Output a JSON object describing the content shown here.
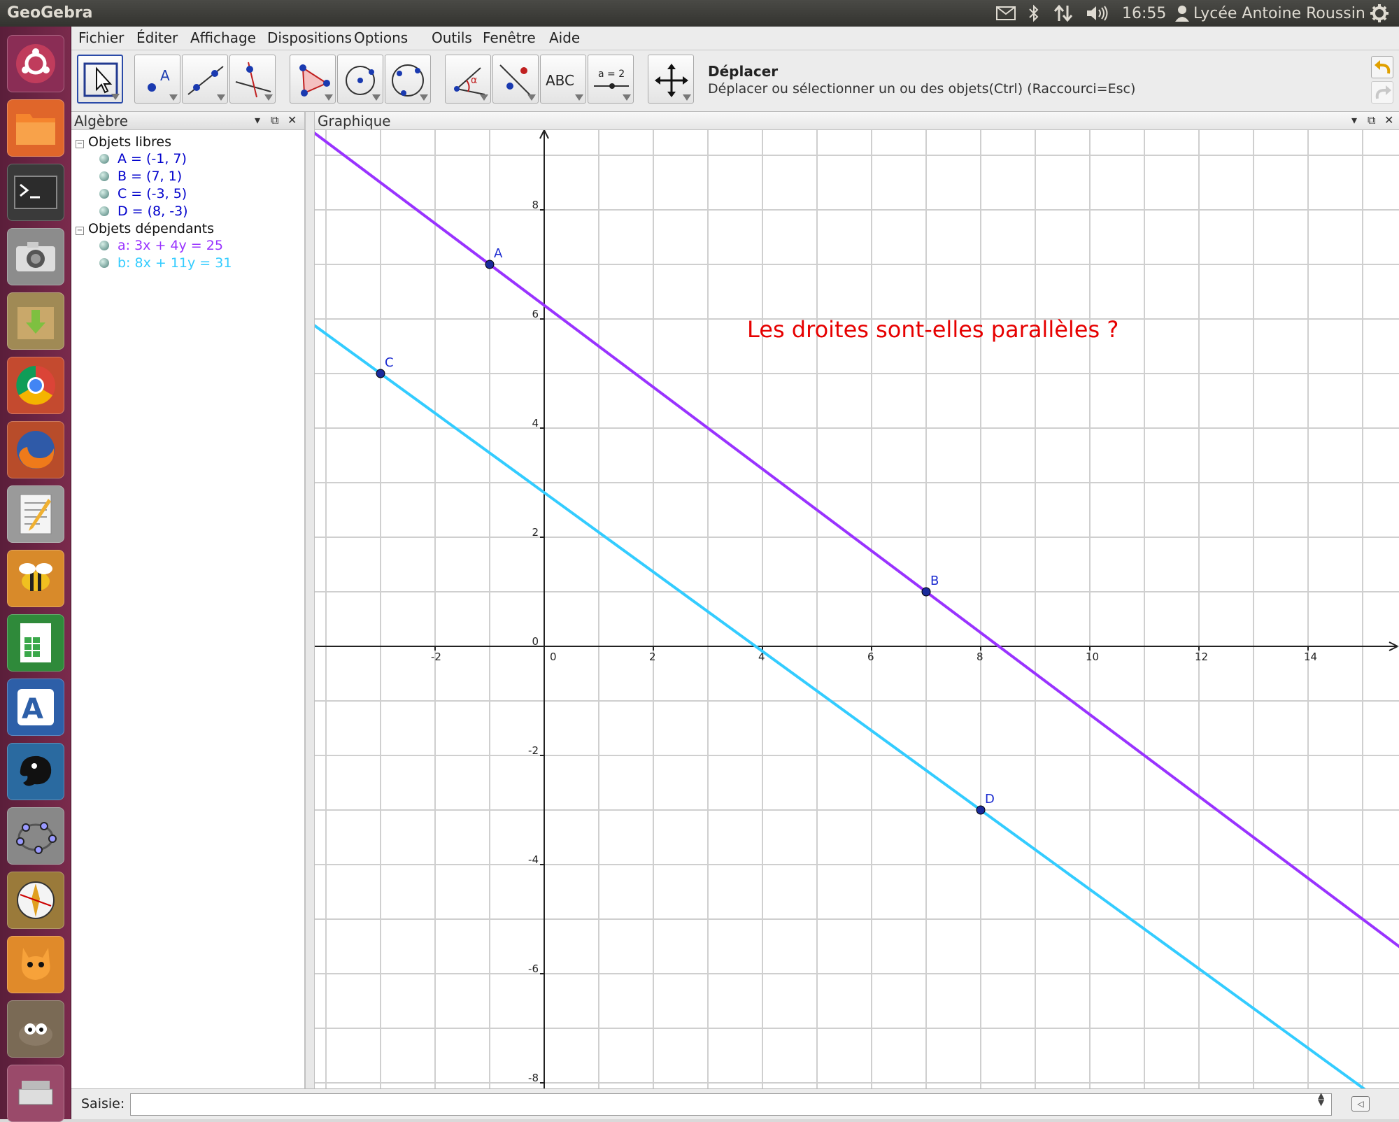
{
  "topbar": {
    "title": "GeoGebra",
    "time": "16:55",
    "user": "Lycée Antoine Roussin",
    "icons": [
      "mail-icon",
      "bluetooth-icon",
      "network-icon",
      "volume-icon",
      "user-icon",
      "settings-gear-icon"
    ]
  },
  "launcher": {
    "apps": [
      "ubuntu-home",
      "files",
      "terminal",
      "camera",
      "archive-manager",
      "chrome",
      "firefox",
      "text-editor",
      "bee-app",
      "spreadsheet",
      "algo-app",
      "gimp-paw",
      "geogebra",
      "compass-app",
      "scratch",
      "gimp",
      "scanner"
    ]
  },
  "menu": {
    "items": [
      "Fichier",
      "Éditer",
      "Affichage",
      "Dispositions",
      "Options",
      "Outils",
      "Fenêtre",
      "Aide"
    ]
  },
  "toolbar": {
    "tool_name": "Déplacer",
    "tool_desc": "Déplacer ou sélectionner un ou des objets(Ctrl) (Raccourci=Esc)",
    "abc_label": "ABC",
    "slider_label": "a = 2"
  },
  "algebra": {
    "title": "Algèbre",
    "free_header": "Objets libres",
    "free": [
      {
        "text": "A = (-1, 7)",
        "color": "#0000cc"
      },
      {
        "text": "B = (7, 1)",
        "color": "#0000cc"
      },
      {
        "text": "C = (-3, 5)",
        "color": "#0000cc"
      },
      {
        "text": "D = (8, -3)",
        "color": "#0000cc"
      }
    ],
    "dep_header": "Objets dépendants",
    "dependent": [
      {
        "text": "a: 3x + 4y = 25",
        "color": "#9933ff"
      },
      {
        "text": "b: 8x + 11y = 31",
        "color": "#33ccff"
      }
    ]
  },
  "graphics": {
    "title": "Graphique",
    "question": "Les droites sont-elles parallèles ?",
    "question_color": "#e60000"
  },
  "chart_data": {
    "type": "line",
    "xlim": [
      -4,
      15.5
    ],
    "ylim": [
      -8.5,
      9
    ],
    "grid": true,
    "x_ticks": [
      -2,
      0,
      2,
      4,
      6,
      8,
      10,
      12,
      14
    ],
    "y_ticks": [
      -8,
      -6,
      -4,
      -2,
      0,
      2,
      4,
      6,
      8
    ],
    "points": [
      {
        "name": "A",
        "x": -1,
        "y": 7
      },
      {
        "name": "B",
        "x": 7,
        "y": 1
      },
      {
        "name": "C",
        "x": -3,
        "y": 5
      },
      {
        "name": "D",
        "x": 8,
        "y": -3
      }
    ],
    "lines": [
      {
        "a": 3,
        "b": 4,
        "c": 25,
        "color": "#9933ff"
      },
      {
        "a": 8,
        "b": 11,
        "c": 31,
        "color": "#33ccff"
      }
    ]
  },
  "input": {
    "label": "Saisie:",
    "value": ""
  }
}
